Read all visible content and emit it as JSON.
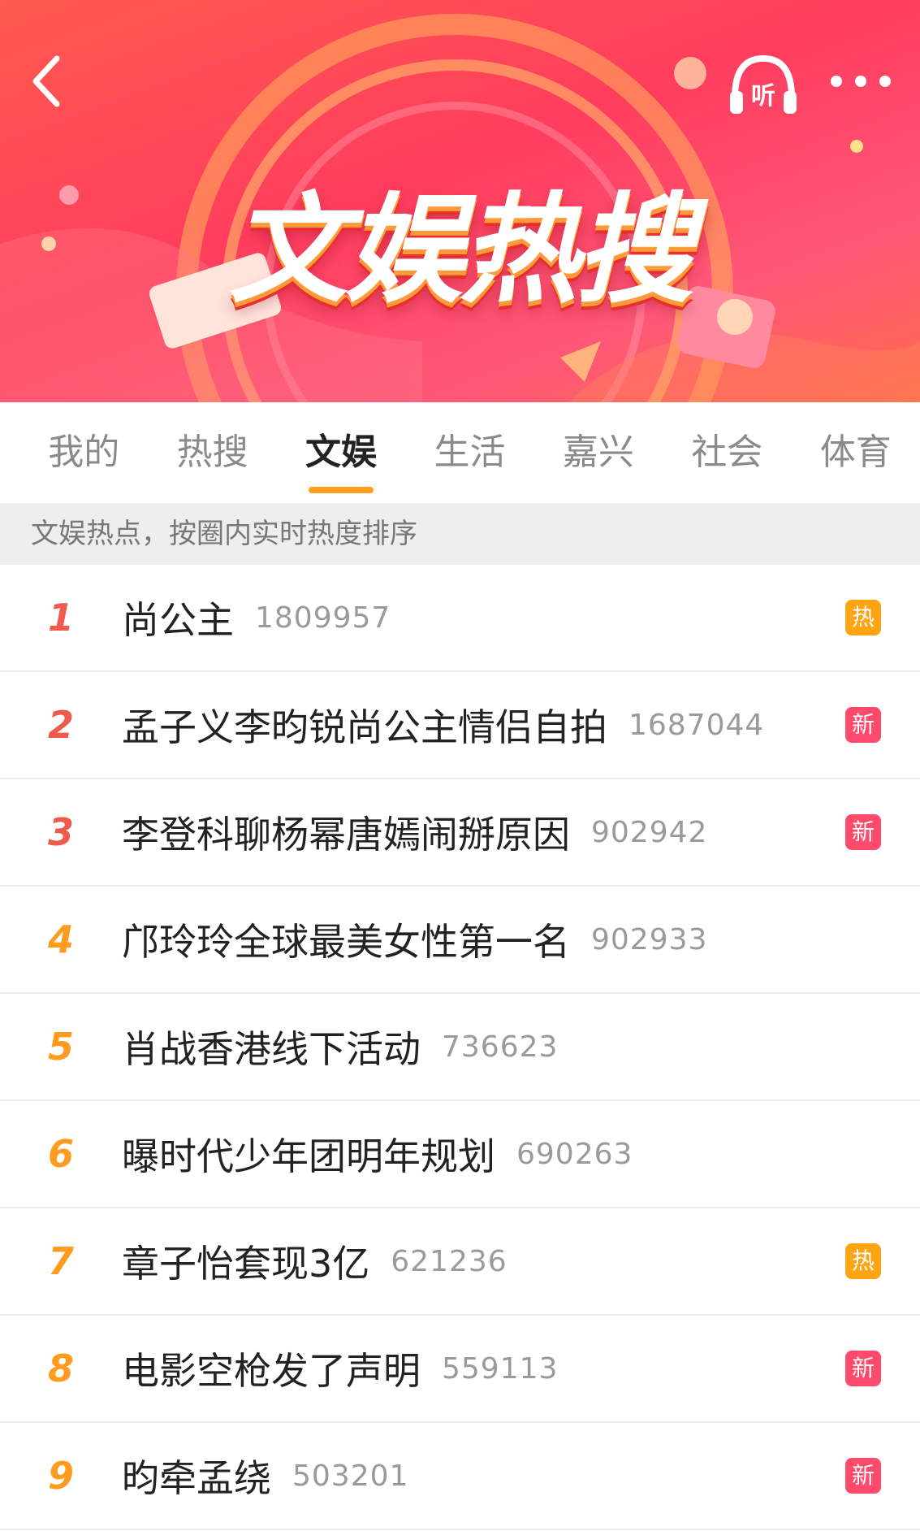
{
  "banner": {
    "title": "文娱热搜",
    "listen_label": "听"
  },
  "tabs": [
    {
      "label": "我的",
      "active": false
    },
    {
      "label": "热搜",
      "active": false
    },
    {
      "label": "文娱",
      "active": true
    },
    {
      "label": "生活",
      "active": false
    },
    {
      "label": "嘉兴",
      "active": false
    },
    {
      "label": "社会",
      "active": false
    },
    {
      "label": "体育",
      "active": false
    }
  ],
  "subtitle": "文娱热点，按圈内实时热度排序",
  "list": [
    {
      "rank": "1",
      "title": "尚公主",
      "count": "1809957",
      "badge": "热",
      "badge_type": "hot"
    },
    {
      "rank": "2",
      "title": "孟子义李昀锐尚公主情侣自拍",
      "count": "1687044",
      "badge": "新",
      "badge_type": "new"
    },
    {
      "rank": "3",
      "title": "李登科聊杨幂唐嫣闹掰原因",
      "count": "902942",
      "badge": "新",
      "badge_type": "new"
    },
    {
      "rank": "4",
      "title": "邝玲玲全球最美女性第一名",
      "count": "902933",
      "badge": "",
      "badge_type": ""
    },
    {
      "rank": "5",
      "title": "肖战香港线下活动",
      "count": "736623",
      "badge": "",
      "badge_type": ""
    },
    {
      "rank": "6",
      "title": "曝时代少年团明年规划",
      "count": "690263",
      "badge": "",
      "badge_type": ""
    },
    {
      "rank": "7",
      "title": "章子怡套现3亿",
      "count": "621236",
      "badge": "热",
      "badge_type": "hot"
    },
    {
      "rank": "8",
      "title": "电影空枪发了声明",
      "count": "559113",
      "badge": "新",
      "badge_type": "new"
    },
    {
      "rank": "9",
      "title": "昀牵孟绕",
      "count": "503201",
      "badge": "新",
      "badge_type": "new"
    }
  ],
  "colors": {
    "accent": "#ff9d1c",
    "top_rank": "#ef5a4d",
    "rank": "#ff9b1f",
    "hot_badge": "#ffa514",
    "new_badge": "#ff4a6b"
  }
}
